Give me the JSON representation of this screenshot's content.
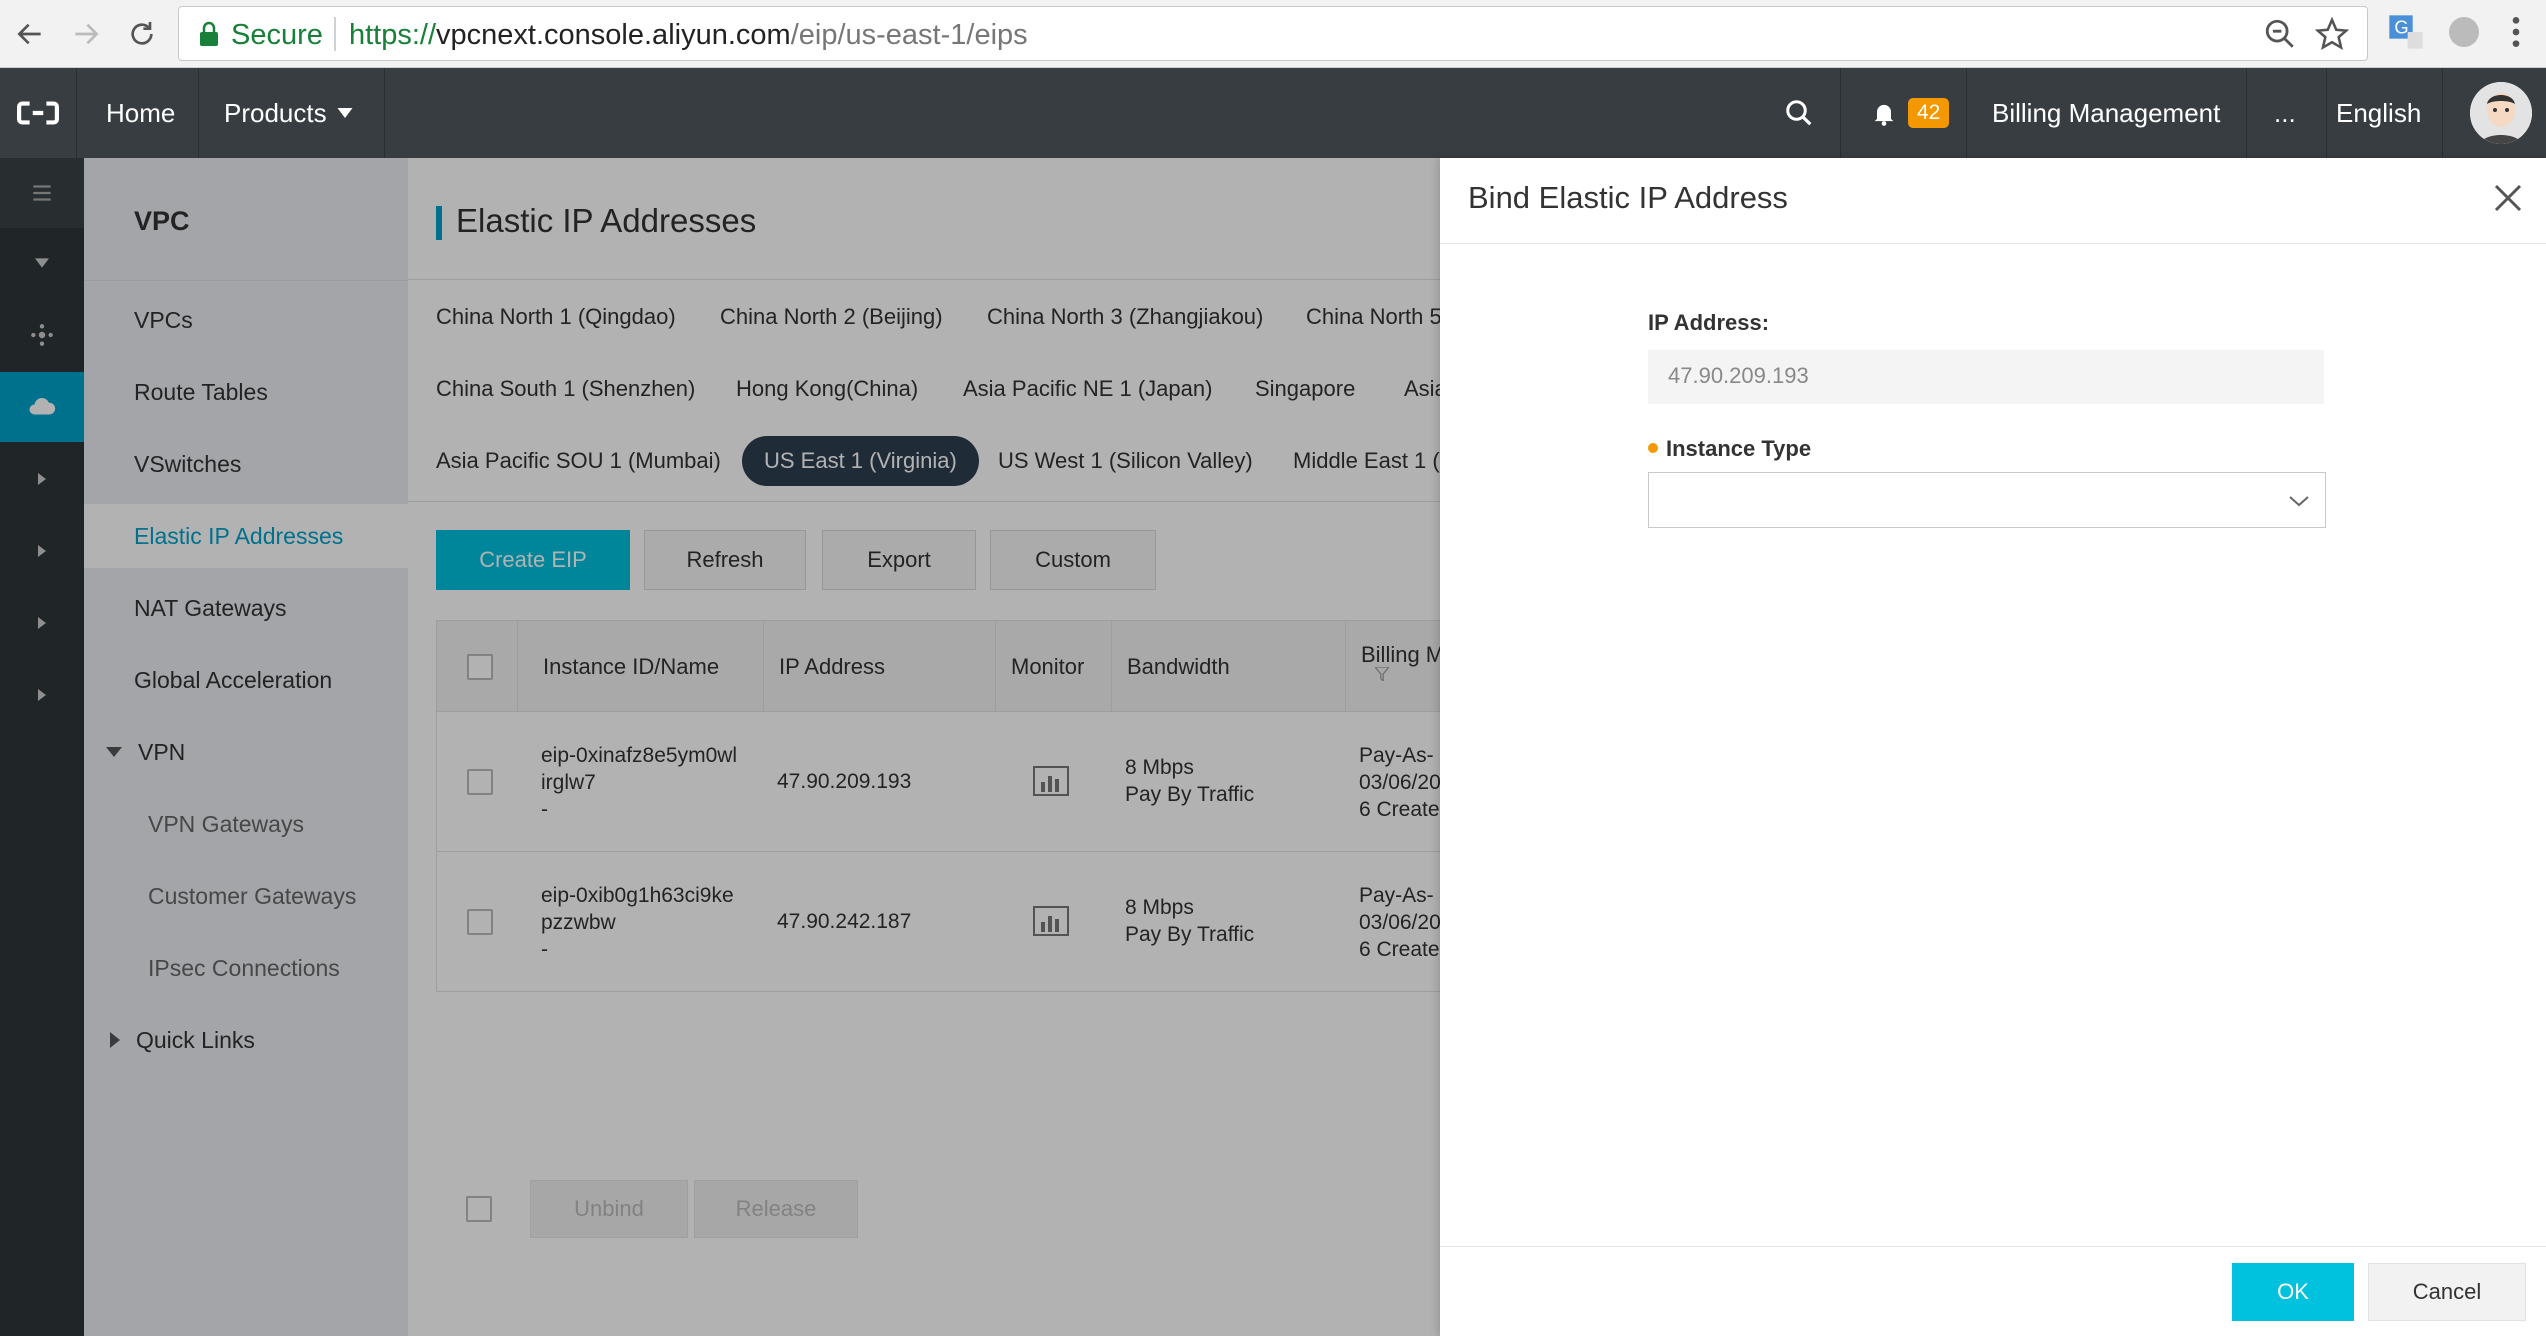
{
  "browser": {
    "secure_label": "Secure",
    "url_scheme": "https://",
    "url_host": "vpcnext.console.aliyun.com",
    "url_path": "/eip/us-east-1/eips"
  },
  "topbar": {
    "home": "Home",
    "products": "Products",
    "notifications_count": "42",
    "billing": "Billing Management",
    "more": "...",
    "language": "English"
  },
  "sidebar": {
    "title": "VPC",
    "items": [
      {
        "label": "VPCs"
      },
      {
        "label": "Route Tables"
      },
      {
        "label": "VSwitches"
      },
      {
        "label": "Elastic IP Addresses"
      },
      {
        "label": "NAT Gateways"
      },
      {
        "label": "Global Acceleration"
      },
      {
        "label": "VPN"
      },
      {
        "label": "VPN Gateways"
      },
      {
        "label": "Customer Gateways"
      },
      {
        "label": "IPsec Connections"
      },
      {
        "label": "Quick Links"
      }
    ]
  },
  "main": {
    "title": "Elastic IP Addresses",
    "regions": [
      "China North 1 (Qingdao)",
      "China North 2 (Beijing)",
      "China North 3 (Zhangjiakou)",
      "China North 5",
      "China South 1 (Shenzhen)",
      "Hong Kong(China)",
      "Asia Pacific NE 1 (Japan)",
      "Singapore",
      "Asia",
      "Asia Pacific SOU 1 (Mumbai)",
      "US East 1 (Virginia)",
      "US West 1 (Silicon Valley)",
      "Middle East 1 ("
    ],
    "toolbar": {
      "create": "Create EIP",
      "refresh": "Refresh",
      "export": "Export",
      "custom": "Custom"
    },
    "table": {
      "headers": [
        "Instance ID/Name",
        "IP Address",
        "Monitor",
        "Bandwidth",
        "Billing M"
      ],
      "rows": [
        {
          "id_line1": "eip-0xinafz8e5ym0wl",
          "id_line2": "irglw7",
          "name": "-",
          "ip": "47.90.209.193",
          "bw_line1": "8 Mbps",
          "bw_line2": "Pay By Traffic",
          "bill_line1": "Pay-As-",
          "bill_line2": "03/06/20",
          "bill_line3": "6 Create"
        },
        {
          "id_line1": "eip-0xib0g1h63ci9ke",
          "id_line2": "pzzwbw",
          "name": "-",
          "ip": "47.90.242.187",
          "bw_line1": "8 Mbps",
          "bw_line2": "Pay By Traffic",
          "bill_line1": "Pay-As-",
          "bill_line2": "03/06/20",
          "bill_line3": "6 Create"
        }
      ]
    },
    "footer": {
      "unbind": "Unbind",
      "release": "Release"
    }
  },
  "dialog": {
    "title": "Bind Elastic IP Address",
    "ip_label": "IP Address:",
    "ip_value": "47.90.209.193",
    "instance_type_label": "Instance Type",
    "instance_type_value": "",
    "ok": "OK",
    "cancel": "Cancel"
  },
  "colors": {
    "accent": "#00c1de",
    "topbar": "#373d41",
    "active_nav": "#00a2ca",
    "badge": "#f39800"
  }
}
